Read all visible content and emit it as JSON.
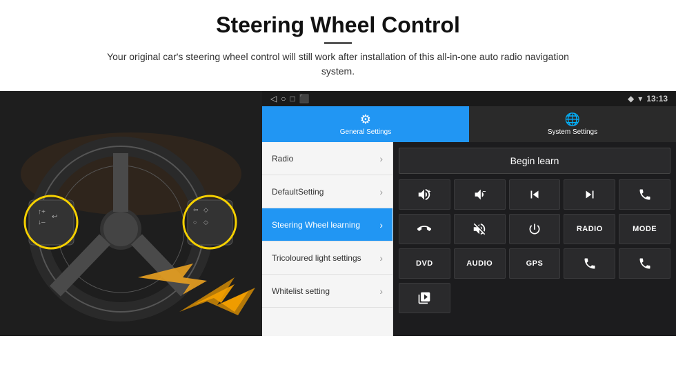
{
  "header": {
    "title": "Steering Wheel Control",
    "subtitle": "Your original car's steering wheel control will still work after installation of this all-in-one auto radio navigation system."
  },
  "tabs": [
    {
      "label": "General Settings",
      "icon": "⚙",
      "active": true
    },
    {
      "label": "System Settings",
      "icon": "🌐",
      "active": false
    }
  ],
  "statusBar": {
    "icons": [
      "◁",
      "○",
      "□",
      "⬛"
    ],
    "rightIcons": "◆ ▾",
    "time": "13:13"
  },
  "menuItems": [
    {
      "label": "Radio",
      "active": false
    },
    {
      "label": "DefaultSetting",
      "active": false
    },
    {
      "label": "Steering Wheel learning",
      "active": true
    },
    {
      "label": "Tricoloured light settings",
      "active": false
    },
    {
      "label": "Whitelist setting",
      "active": false
    }
  ],
  "controls": {
    "beginLearn": "Begin learn",
    "row1": [
      "🔊+",
      "🔊–",
      "⏮",
      "⏭",
      "📞"
    ],
    "row2": [
      "↩",
      "🔇",
      "⏻",
      "RADIO",
      "MODE"
    ],
    "row3": [
      "DVD",
      "AUDIO",
      "GPS",
      "📞⏮",
      "📞⏭"
    ],
    "row4": [
      "🖼"
    ]
  }
}
